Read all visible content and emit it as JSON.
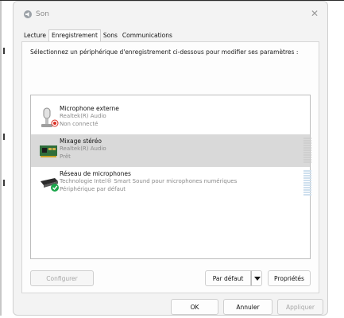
{
  "window": {
    "title": "Son",
    "close_glyph": "✕"
  },
  "tabs": [
    {
      "label": "Lecture"
    },
    {
      "label": "Enregistrement",
      "active": true
    },
    {
      "label": "Sons"
    },
    {
      "label": "Communications"
    }
  ],
  "panel": {
    "instruction": "Sélectionnez un périphérique d'enregistrement ci-dessous pour modifier ses paramètres :"
  },
  "devices": [
    {
      "name": "Microphone externe",
      "driver": "Realtek(R) Audio",
      "status": "Non connecté",
      "icon": "external-microphone-icon",
      "badge": "disconnected-badge-icon"
    },
    {
      "name": "Mixage stéréo",
      "driver": "Realtek(R) Audio",
      "status": "Prêt",
      "icon": "sound-card-icon",
      "selected": true
    },
    {
      "name": "Réseau de microphones",
      "driver": "Technologie Intel® Smart Sound pour microphones numériques",
      "status": "Périphérique par défaut",
      "icon": "microphone-array-icon",
      "badge": "default-check-badge-icon"
    }
  ],
  "buttons": {
    "configure": "Configurer",
    "set_default": "Par défaut",
    "properties": "Propriétés",
    "ok": "OK",
    "cancel": "Annuler",
    "apply": "Appliquer"
  },
  "colors": {
    "selected_row": "#d9d9d9",
    "default_badge": "#1aa64a",
    "disconnected_badge": "#d93025",
    "meter_blue": "#cfe0ee"
  }
}
